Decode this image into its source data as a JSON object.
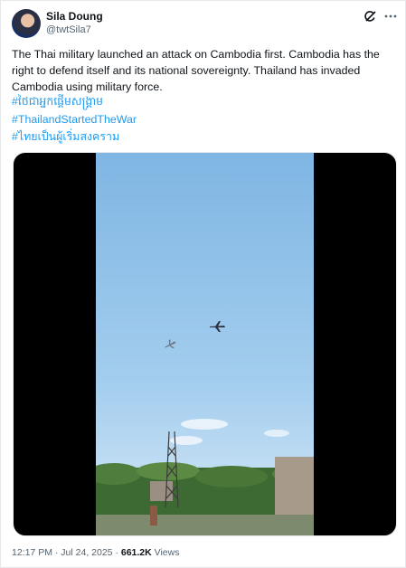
{
  "user": {
    "display_name": "Sila Doung",
    "handle": "@twtSila7"
  },
  "tweet": {
    "text": "The Thai military launched an attack on Cambodia first. Cambodia has the right to defend itself and its national sovereignty. Thailand has invaded Cambodia using military force.",
    "hashtags": [
      "#ថៃជាអ្នកផ្តើមសង្គ្រាម",
      "#ThailandStartedTheWar",
      "#ไทยเป็นผู้เริ่มสงคราม"
    ]
  },
  "footer": {
    "time": "12:17 PM",
    "separator1": "·",
    "date": "Jul 24, 2025",
    "separator2": "·",
    "views_count": "661.2K",
    "views_label": "Views"
  },
  "colors": {
    "link": "#1d9bf0",
    "secondary_text": "#536471",
    "sky": "#8fc0e6"
  },
  "icons": {
    "grok": "grok-icon",
    "more": "more-icon"
  }
}
